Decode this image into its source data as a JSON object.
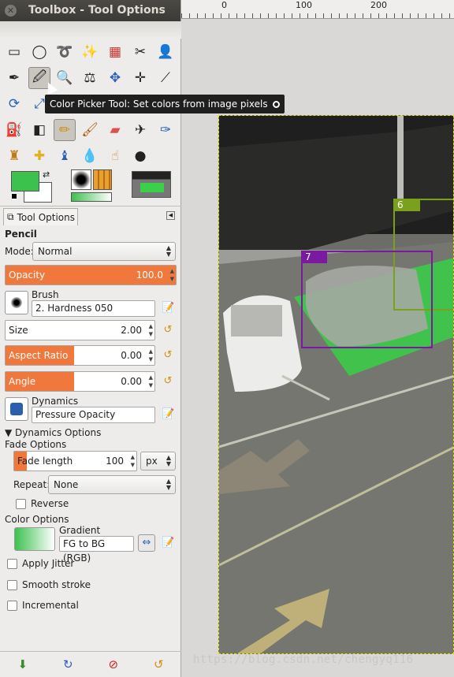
{
  "window": {
    "title": "Toolbox - Tool Options"
  },
  "tooltip": {
    "text": "Color Picker Tool: Set colors from image pixels"
  },
  "ruler": {
    "ticks": [
      "0",
      "100",
      "200"
    ]
  },
  "tab": {
    "label": "Tool Options"
  },
  "tool_options": {
    "tool_name": "Pencil",
    "mode_label": "Mode:",
    "mode_value": "Normal",
    "opacity": {
      "label": "Opacity",
      "value": "100.0",
      "fill": 1.0
    },
    "brush": {
      "label": "Brush",
      "value": "2. Hardness 050"
    },
    "size": {
      "label": "Size",
      "value": "2.00"
    },
    "aspect_ratio": {
      "label": "Aspect Ratio",
      "value": "0.00",
      "fill": 0.5
    },
    "angle": {
      "label": "Angle",
      "value": "0.00",
      "fill": 0.5
    },
    "dynamics": {
      "label": "Dynamics",
      "value": "Pressure Opacity"
    },
    "dynamics_options": "Dynamics Options",
    "fade_options": "Fade Options",
    "fade_length": {
      "label": "Fade length",
      "value": "100",
      "unit": "px"
    },
    "repeat": {
      "label": "Repeat:",
      "value": "None"
    },
    "reverse": "Reverse",
    "color_options": "Color Options",
    "gradient": {
      "label": "Gradient",
      "value": "FG to BG (RGB)"
    },
    "apply_jitter": "Apply Jitter",
    "smooth_stroke": "Smooth stroke",
    "incremental": "Incremental"
  },
  "image": {
    "boxes": [
      {
        "label": "6",
        "color": "#7aa01e"
      },
      {
        "label": "7",
        "color": "#7a1aa0"
      }
    ]
  },
  "watermark": "https://blog.csdn.net/chengyq116",
  "colors": {
    "fg": "#3cc14f",
    "bg": "#ffffff",
    "accent": "#f0783c"
  }
}
